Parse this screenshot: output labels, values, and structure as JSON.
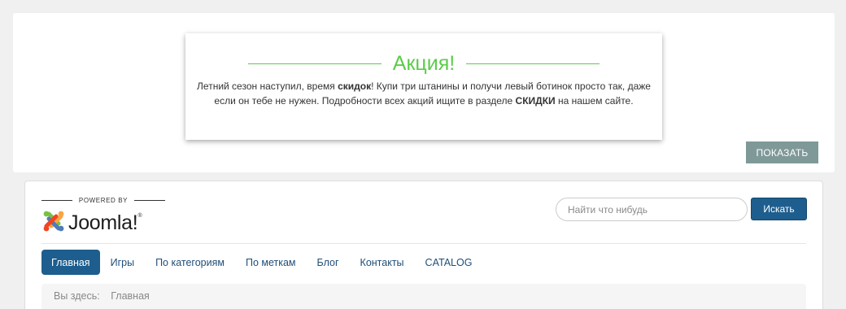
{
  "promo": {
    "title": "Акция!",
    "text_part1": "Летний сезон наступил, время ",
    "text_bold1": "скидок",
    "text_part2": "! Купи три штанины и получи левый ботинок просто так, даже если он тебе не нужен. Подробности всех акций ищите в разделе ",
    "text_bold2": "СКИДКИ",
    "text_part3": " на нашем сайте.",
    "show_label": "ПОКАЗАТЬ",
    "accent_color": "#5ccc4a"
  },
  "header": {
    "powered_by": "POWERED BY",
    "logo_text": "Joomla!",
    "logo_mark": "®",
    "logo_icon": "joomla-logo-icon"
  },
  "search": {
    "placeholder": "Найти что нибудь",
    "value": "",
    "button_label": "Искать"
  },
  "nav": {
    "items": [
      {
        "label": "Главная",
        "active": true
      },
      {
        "label": "Игры",
        "active": false
      },
      {
        "label": "По категориям",
        "active": false
      },
      {
        "label": "По меткам",
        "active": false
      },
      {
        "label": "Блог",
        "active": false
      },
      {
        "label": "Контакты",
        "active": false
      },
      {
        "label": "CATALOG",
        "active": false
      }
    ]
  },
  "breadcrumb": {
    "label": "Вы здесь:",
    "items": [
      "Главная"
    ]
  },
  "colors": {
    "primary": "#1d5e8e",
    "promo_button": "#7f9998"
  }
}
